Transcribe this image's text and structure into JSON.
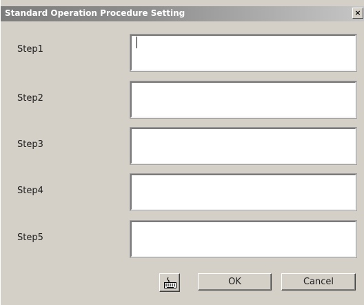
{
  "window": {
    "title": "Standard Operation Procedure Setting",
    "close_glyph": "×"
  },
  "steps": [
    {
      "label": "Step1",
      "value": ""
    },
    {
      "label": "Step2",
      "value": ""
    },
    {
      "label": "Step3",
      "value": ""
    },
    {
      "label": "Step4",
      "value": ""
    },
    {
      "label": "Step5",
      "value": ""
    }
  ],
  "buttons": {
    "keyboard_icon": "keyboard-icon",
    "ok_label": "OK",
    "cancel_label": "Cancel"
  },
  "colors": {
    "dialog_bg": "#d4d0c8",
    "titlebar_start": "#7d7d7d",
    "titlebar_end": "#c6c6c6"
  }
}
